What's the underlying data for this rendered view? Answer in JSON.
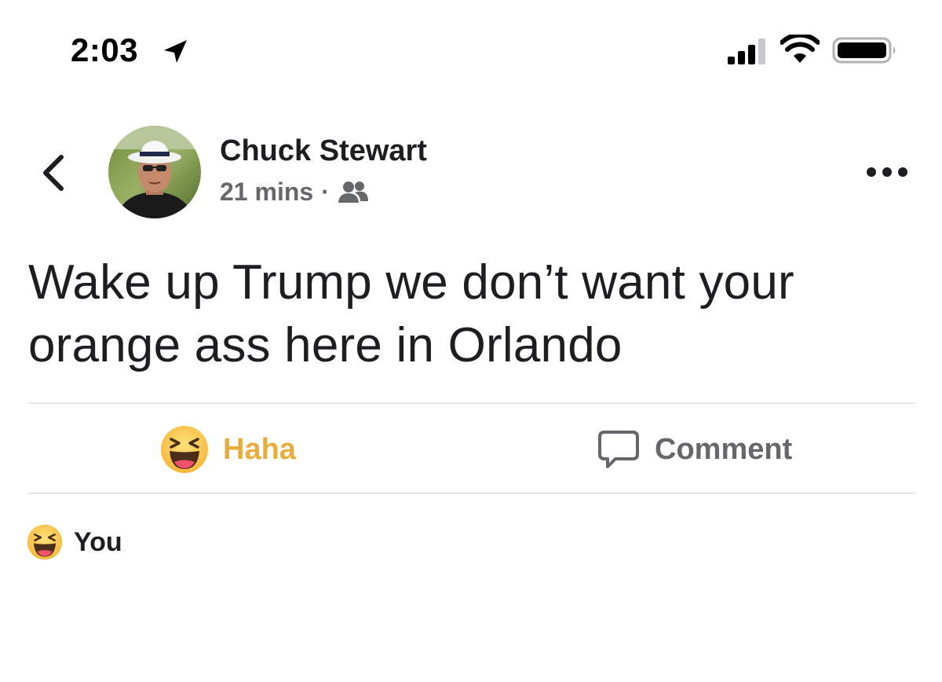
{
  "status_bar": {
    "time": "2:03",
    "icons": [
      "location-arrow-icon",
      "cellular-signal-icon",
      "wifi-icon",
      "battery-icon"
    ]
  },
  "post": {
    "author": "Chuck Stewart",
    "timestamp": "21 mins",
    "separator": "·",
    "audience_icon": "friends-icon",
    "text": "Wake up Trump we don’t want your orange ass here in Orlando"
  },
  "actions": {
    "haha_label": "Haha",
    "comment_label": "Comment"
  },
  "reactions": {
    "summary_label": "You"
  },
  "colors": {
    "haha_accent": "#e8ae3b",
    "secondary_text": "#65676b",
    "primary_text": "#1c1e21",
    "divider": "#e4e6eb"
  }
}
